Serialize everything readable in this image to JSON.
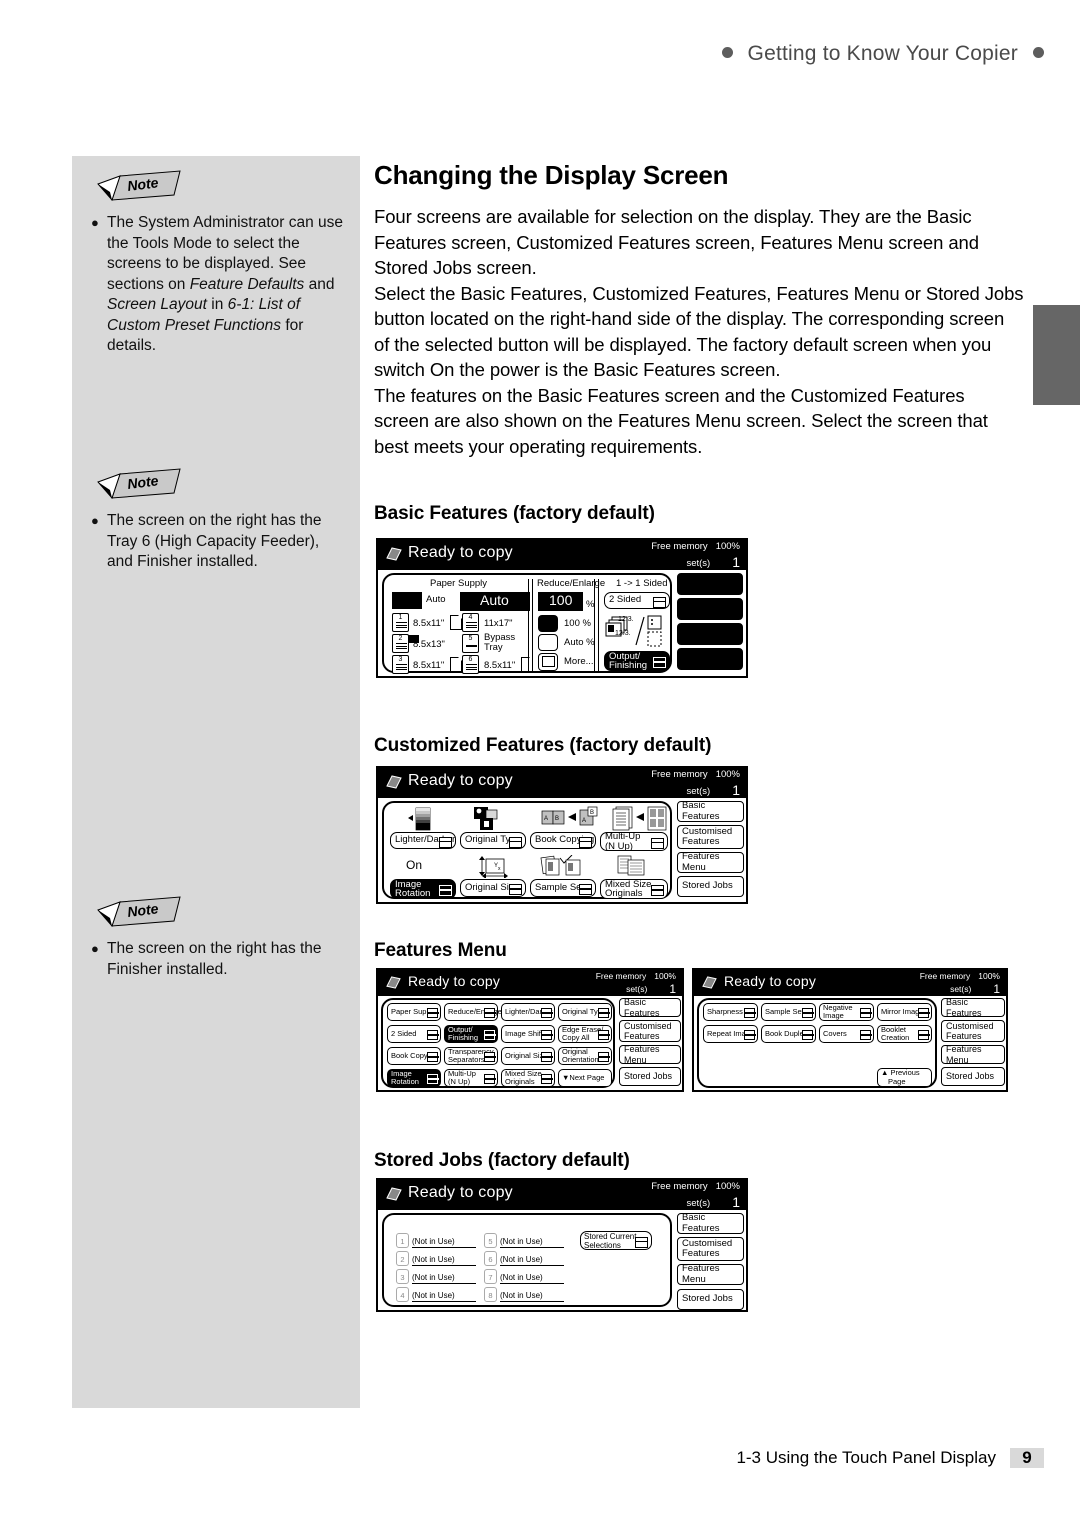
{
  "running_head": {
    "text": "Getting to Know Your Copier"
  },
  "footer": {
    "section": "1-3  Using the Touch Panel Display",
    "page": "9"
  },
  "notes": [
    {
      "flag": "Note",
      "lines": "The System Administrator can use the Tools Mode to select the screens to be displayed. See sections on Feature Defaults and Screen Layout in 6-1: List of Custom Preset Functions for details.",
      "segments": [
        {
          "t": "The System Administrator can use the Tools Mode to select the screens to be displayed. See sections on ",
          "i": false
        },
        {
          "t": "Feature Defaults",
          "i": true
        },
        {
          "t": " and ",
          "i": false
        },
        {
          "t": "Screen Layout",
          "i": true
        },
        {
          "t": " in ",
          "i": false
        },
        {
          "t": "6-1: List of Custom Preset Functions",
          "i": true
        },
        {
          "t": " for details.",
          "i": false
        }
      ]
    },
    {
      "flag": "Note",
      "lines": "The screen on the right has the Tray 6 (High Capacity Feeder), and Finisher installed.",
      "segments": [
        {
          "t": "The screen on the right has the Tray 6 (High Capacity Feeder), and Finisher installed.",
          "i": false
        }
      ]
    },
    {
      "flag": "Note",
      "lines": "The screen on the right has the Finisher installed.",
      "segments": [
        {
          "t": "The screen on the right has the Finisher installed.",
          "i": false
        }
      ]
    }
  ],
  "article": {
    "title": "Changing the Display Screen",
    "paragraphs": [
      "Four screens are available for selection on the display. They are the Basic Features screen, Customized Features screen, Features Menu screen and Stored Jobs screen.",
      "Select the Basic Features, Customized Features, Features Menu or Stored Jobs button located on the right-hand side of the display. The corresponding screen of the selected button will be displayed. The factory default screen when you switch On the power is the Basic Features screen.",
      "The features on the Basic Features screen and the Customized Features screen are also shown on the Features Menu screen. Select the screen that best meets your operating requirements."
    ]
  },
  "sections": {
    "basic": {
      "heading": "Basic Features (factory default)"
    },
    "customized": {
      "heading": "Customized Features (factory default)"
    },
    "features_menu": {
      "heading": "Features Menu"
    },
    "stored_jobs": {
      "heading": "Stored Jobs (factory default)"
    }
  },
  "lcd_common": {
    "status": "Ready to copy",
    "free_memory_label": "Free memory",
    "free_memory_value": "100%",
    "sets_label": "set(s)",
    "sets_value": "1"
  },
  "screen_buttons": {
    "basic_features": "Basic Features",
    "customised_features": "Customised Features",
    "features_menu": "Features Menu",
    "stored_jobs": "Stored Jobs"
  },
  "basic_screen": {
    "paper_supply_title": "Paper Supply",
    "paper_auto_label": "Auto",
    "paper_auto_big": "Auto",
    "trays": [
      {
        "num": "1",
        "size": "8.5x11\""
      },
      {
        "num": "2",
        "size": "8.5x13\""
      },
      {
        "num": "3",
        "size": "8.5x11\""
      },
      {
        "num": "4",
        "size": "11x17\""
      },
      {
        "num": "5",
        "size": "Bypass Tray"
      },
      {
        "num": "6",
        "size": "8.5x11\""
      }
    ],
    "reduce_enlarge_title": "Reduce/Enlarge",
    "re_value": "100",
    "re_percent": "%",
    "re_options": [
      "100 %",
      "Auto %",
      "More..."
    ],
    "sided_title": "1 -> 1 Sided",
    "two_sided": "2  Sided",
    "output_finishing": "Output/ Finishing",
    "output_finishing_l1": "Output/",
    "output_finishing_l2": "Finishing",
    "doc_marks": [
      "12.3.",
      "12.3."
    ]
  },
  "customized_screen": {
    "row1": [
      {
        "label": "Lighter/Darker",
        "icon": "density-gradient-icon",
        "inverted": false
      },
      {
        "label": "Original Type",
        "icon": "original-type-icon",
        "inverted": false
      },
      {
        "label": "Book Copying",
        "icon": "book-copy-icon",
        "inverted": false
      },
      {
        "label": "Multi-Up (N Up)",
        "l1": "Multi-Up",
        "l2": "(N Up)",
        "icon": "multi-up-icon",
        "inverted": false
      }
    ],
    "row2": [
      {
        "label": "Image Rotation",
        "l1": "Image",
        "l2": "Rotation",
        "icon": "image-rotation-icon",
        "inverted": true,
        "state": "On"
      },
      {
        "label": "Original Size",
        "icon": "original-size-icon",
        "inverted": false
      },
      {
        "label": "Sample Set",
        "icon": "sample-set-icon",
        "inverted": false
      },
      {
        "label": "Mixed Size Originals",
        "l1": "Mixed Size",
        "l2": "Originals",
        "icon": "mixed-size-icon",
        "inverted": false
      }
    ],
    "image_rotation_state": "On"
  },
  "features_menu_page1": {
    "buttons": [
      {
        "l1": "Paper Supply",
        "l2": "",
        "inverted": false
      },
      {
        "l1": "Reduce/Enlarge",
        "l2": "",
        "inverted": false
      },
      {
        "l1": "Lighter/Darker",
        "l2": "",
        "inverted": false
      },
      {
        "l1": "Original Type",
        "l2": "",
        "inverted": false
      },
      {
        "l1": "2 Sided",
        "l2": "",
        "inverted": false
      },
      {
        "l1": "Output/",
        "l2": "Finishing",
        "inverted": true
      },
      {
        "l1": "Image Shift",
        "l2": "",
        "inverted": false
      },
      {
        "l1": "Edge Erase/",
        "l2": "Copy All",
        "inverted": false
      },
      {
        "l1": "Book Copying",
        "l2": "",
        "inverted": false
      },
      {
        "l1": "Transparency",
        "l2": "Separators",
        "inverted": false
      },
      {
        "l1": "Original Size",
        "l2": "",
        "inverted": false
      },
      {
        "l1": "Original",
        "l2": "Orientation",
        "inverted": false
      },
      {
        "l1": "Image",
        "l2": "Rotation",
        "inverted": true
      },
      {
        "l1": "Multi-Up",
        "l2": "(N Up)",
        "inverted": false
      },
      {
        "l1": "Mixed Size",
        "l2": "Originals",
        "inverted": false
      },
      {
        "l1": "▼Next Page",
        "l2": "",
        "inverted": false,
        "no_tag": true
      }
    ]
  },
  "features_menu_page2": {
    "buttons": [
      {
        "l1": "Sharpness",
        "l2": "",
        "inverted": false
      },
      {
        "l1": "Sample Set",
        "l2": "",
        "inverted": false
      },
      {
        "l1": "Negative",
        "l2": "Image",
        "inverted": false
      },
      {
        "l1": "Mirror Image",
        "l2": "",
        "inverted": false
      },
      {
        "l1": "Repeat Image",
        "l2": "",
        "inverted": false
      },
      {
        "l1": "Book Duplex",
        "l2": "",
        "inverted": false
      },
      {
        "l1": "Covers",
        "l2": "",
        "inverted": false
      },
      {
        "l1": "Booklet",
        "l2": "Creation",
        "inverted": false
      }
    ],
    "previous_page_l1": "▲ Previous",
    "previous_page_l2": "Page"
  },
  "stored_jobs_screen": {
    "slots": [
      {
        "num": "1",
        "label": "(Not in Use)"
      },
      {
        "num": "2",
        "label": "(Not in Use)"
      },
      {
        "num": "3",
        "label": "(Not in Use)"
      },
      {
        "num": "4",
        "label": "(Not in Use)"
      },
      {
        "num": "5",
        "label": "(Not in Use)"
      },
      {
        "num": "6",
        "label": "(Not in Use)"
      },
      {
        "num": "7",
        "label": "(Not in Use)"
      },
      {
        "num": "8",
        "label": "(Not in Use)"
      }
    ],
    "store_button_l1": "Stored Current",
    "store_button_l2": "Selections"
  },
  "colors": {
    "note_panel": "#d9d9d9",
    "thumb_tab": "#666666",
    "page_box": "#d9d9d9",
    "running_head": "#4a4a4a"
  }
}
